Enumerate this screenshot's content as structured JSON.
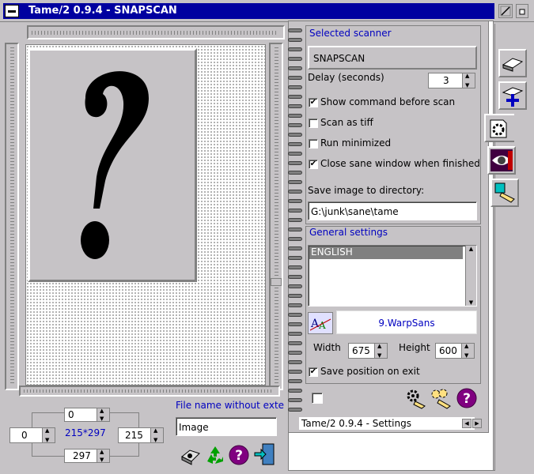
{
  "window": {
    "title": "Tame/2 0.9.4 - SNAPSCAN"
  },
  "left": {
    "filename_label": "File name without exte",
    "filename_value": "Image",
    "top_value": "0",
    "left_value": "0",
    "right_value": "215",
    "bottom_value": "297",
    "size_label": "215*297"
  },
  "settings": {
    "selected_scanner_label": "Selected scanner",
    "scanner_button": "SNAPSCAN",
    "delay_label": "Delay (seconds)",
    "delay_value": "3",
    "show_command_label": "Show command before scan",
    "show_command_checked": true,
    "scan_tiff_label": "Scan as tiff",
    "scan_tiff_checked": false,
    "run_minimized_label": "Run minimized",
    "run_minimized_checked": false,
    "close_sane_label": "Close sane window when finished",
    "close_sane_checked": true,
    "save_dir_label": "Save image to directory:",
    "save_dir_value": "G:\\junk\\sane\\tame",
    "general_settings_label": "General settings",
    "language_selected": "ENGLISH",
    "font_button": "9.WarpSans",
    "width_label": "Width",
    "width_value": "675",
    "height_label": "Height",
    "height_value": "600",
    "save_position_label": "Save position on exit",
    "save_position_checked": true,
    "status_title": "Tame/2 0.9.4 - Settings"
  },
  "colors": {
    "title_bar": "#0000a0",
    "label_blue": "#0000c0",
    "face": "#c6c3c6"
  }
}
